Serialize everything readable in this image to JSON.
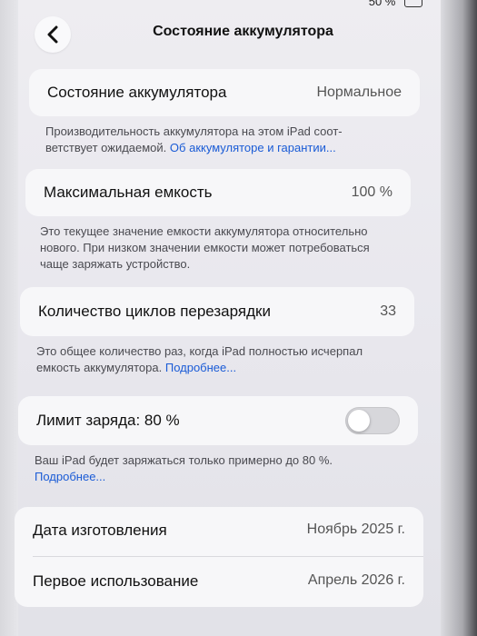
{
  "status": {
    "battery_pct": "50 %"
  },
  "nav": {
    "title": "Состояние аккумулятора",
    "back_icon": "chevron-left-icon"
  },
  "health": {
    "label": "Состояние аккумулятора",
    "value": "Нормальное"
  },
  "health_note": {
    "text": "Производительность аккумулятора на этом iPad соот-ветствует ожидаемой.",
    "link": "Об аккумуляторе и гарантии..."
  },
  "capacity": {
    "label": "Максимальная емкость",
    "value": "100 %"
  },
  "capacity_note": {
    "text": "Это текущее значение емкости аккумулятора относительно нового. При низком значении емкости может потребоваться чаще заряжать устройство."
  },
  "cycles": {
    "label": "Количество циклов перезарядки",
    "value": "33"
  },
  "cycles_note": {
    "text": "Это общее количество раз, когда iPad полностью исчерпал емкость аккумулятора.",
    "link": "Подробнее..."
  },
  "limit": {
    "label": "Лимит заряда: 80 %",
    "toggle_on": false
  },
  "limit_note": {
    "text": "Ваш iPad будет заряжаться только примерно до 80 %.",
    "link": "Подробнее..."
  },
  "dates": {
    "manufacture_label": "Дата изготовления",
    "manufacture_value": "Ноябрь 2025 г.",
    "first_use_label": "Первое использование",
    "first_use_value": "Апрель 2026 г."
  },
  "colors": {
    "link": "#1a5bd6",
    "background": "#eeedf1",
    "card": "#f7f7f9"
  }
}
